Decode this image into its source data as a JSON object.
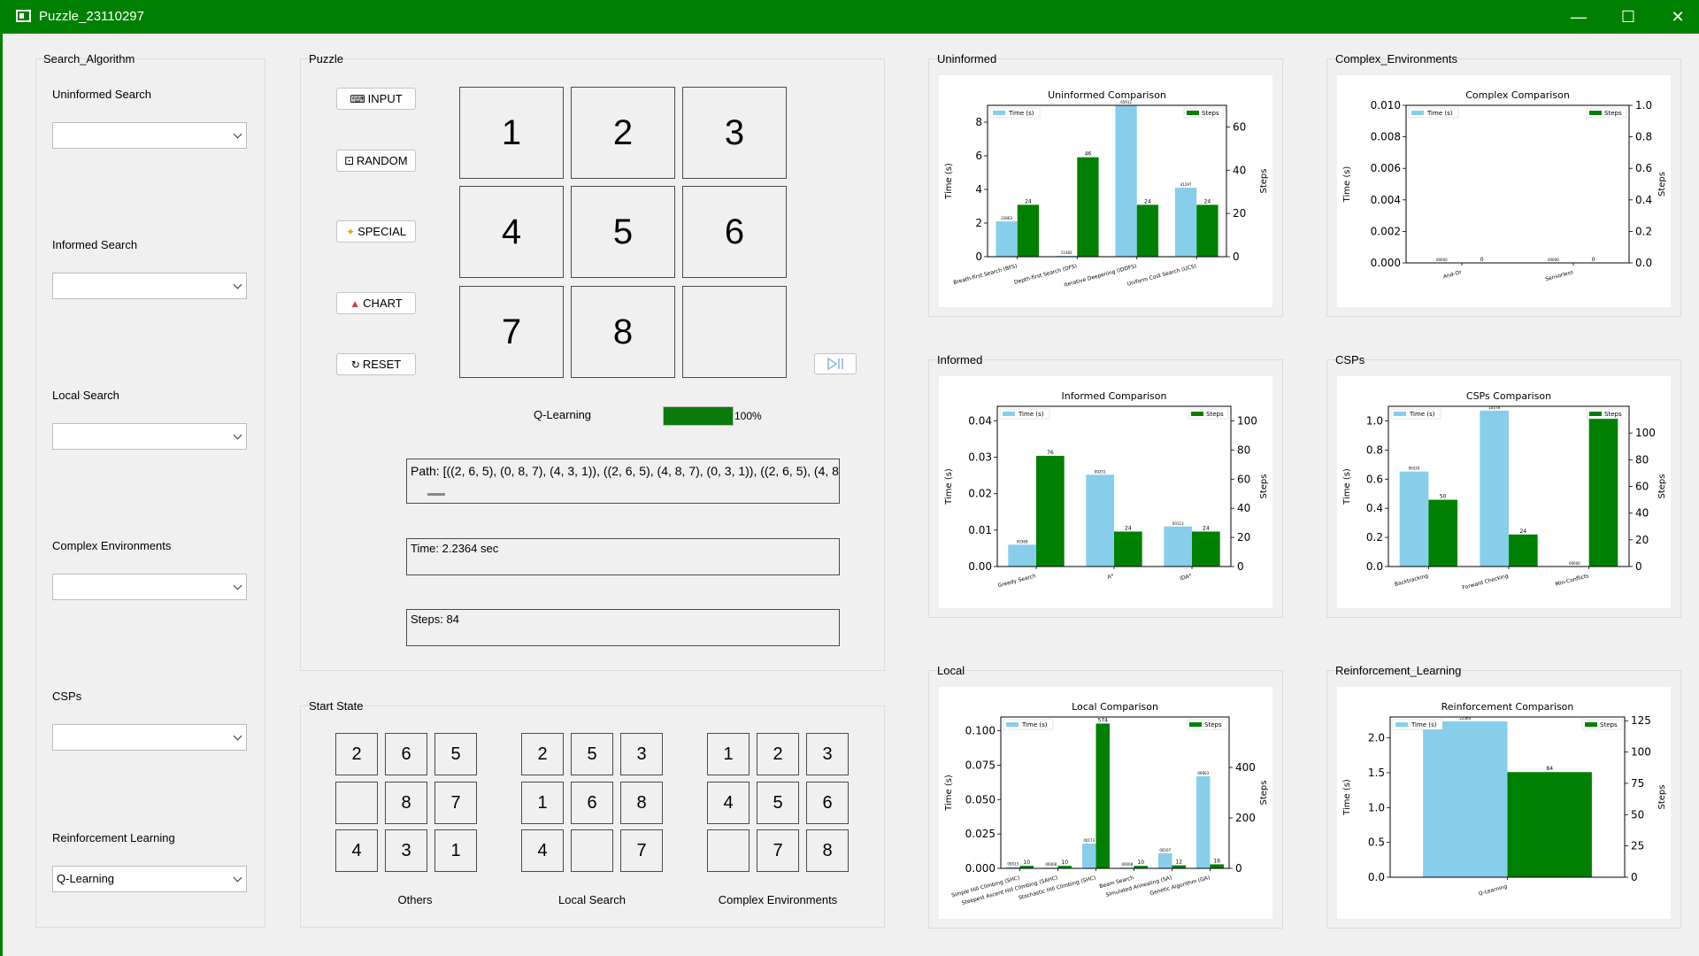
{
  "window": {
    "title": "Puzzle_23110297"
  },
  "sidebar": {
    "title": "Search_Algorithm",
    "groups": [
      {
        "label": "Uninformed Search",
        "value": ""
      },
      {
        "label": "Informed Search",
        "value": ""
      },
      {
        "label": "Local Search",
        "value": ""
      },
      {
        "label": "Complex Environments",
        "value": ""
      },
      {
        "label": "CSPs",
        "value": ""
      },
      {
        "label": "Reinforcement Learning",
        "value": "Q-Learning"
      }
    ]
  },
  "puzzle": {
    "title": "Puzzle",
    "buttons": [
      {
        "label": "INPUT",
        "icon": "keyboard-icon"
      },
      {
        "label": "RANDOM",
        "icon": "dice-icon"
      },
      {
        "label": "SPECIAL",
        "icon": "sparkle-icon"
      },
      {
        "label": "CHART",
        "icon": "chart-icon"
      },
      {
        "label": "RESET",
        "icon": "reset-icon"
      }
    ],
    "tiles": [
      "1",
      "2",
      "3",
      "4",
      "5",
      "6",
      "7",
      "8",
      ""
    ],
    "algorithm_label": "Q-Learning",
    "progress": {
      "value": 100,
      "text": "100%"
    },
    "path_text": "Path: [((2, 6, 5), (0, 8, 7), (4, 3, 1)), ((2, 6, 5), (4, 8, 7), (0, 3, 1)), ((2, 6, 5), (4, 8,",
    "time_text": "Time: 2.2364 sec",
    "steps_text": "Steps: 84"
  },
  "start_state": {
    "title": "Start State",
    "grids": [
      {
        "label": "Others",
        "tiles": [
          "2",
          "6",
          "5",
          "",
          "8",
          "7",
          "4",
          "3",
          "1"
        ]
      },
      {
        "label": "Local Search",
        "tiles": [
          "2",
          "5",
          "3",
          "1",
          "6",
          "8",
          "4",
          "",
          "7"
        ]
      },
      {
        "label": "Complex Environments",
        "tiles": [
          "1",
          "2",
          "3",
          "4",
          "5",
          "6",
          "",
          "7",
          "8"
        ]
      }
    ]
  },
  "panels": {
    "uninformed": "Uninformed",
    "complex": "Complex_Environments",
    "informed": "Informed",
    "csps": "CSPs",
    "local": "Local",
    "rl": "Reinforcement_Learning"
  },
  "colors": {
    "time": "#87ceeb",
    "steps": "#008000",
    "title_bar": "#008000"
  },
  "chart_data": [
    {
      "id": "uninformed",
      "type": "bar",
      "title": "Uninformed Comparison",
      "categories": [
        "Breath-first Search (BFS)",
        "Depth-first Search (DFS)",
        "Iterative Deepening (IDDFS)",
        "Uniform Cost Search (UCS)"
      ],
      "series": [
        {
          "name": "Time (s)",
          "values": [
            2.1,
            0.05,
            9.0,
            4.1
          ]
        },
        {
          "name": "Steps",
          "values": [
            24,
            46,
            24,
            24
          ]
        }
      ],
      "time_labels": [
        "22863",
        "11482",
        "65912",
        "41297"
      ],
      "steps_labels": [
        "24",
        "46",
        "24",
        "24"
      ],
      "ylabel_left": "Time (s)",
      "ylabel_right": "Steps",
      "ylim_left": [
        0,
        9
      ],
      "ylim_right": [
        0,
        70
      ],
      "left_ticks": [
        "0",
        "2",
        "4",
        "6",
        "8"
      ],
      "right_ticks": [
        "0",
        "20",
        "40",
        "60"
      ]
    },
    {
      "id": "complex",
      "type": "bar",
      "title": "Complex Comparison",
      "categories": [
        "And-Or",
        "Sensorless"
      ],
      "series": [
        {
          "name": "Time (s)",
          "values": [
            0,
            0
          ]
        },
        {
          "name": "Steps",
          "values": [
            0,
            0
          ]
        }
      ],
      "time_labels": [
        "00000",
        "00000"
      ],
      "steps_labels": [
        "0",
        "0"
      ],
      "ylabel_left": "Time (s)",
      "ylabel_right": "Steps",
      "ylim_left": [
        0,
        0.01
      ],
      "ylim_right": [
        0,
        1.0
      ],
      "left_ticks": [
        "0.000",
        "0.002",
        "0.004",
        "0.006",
        "0.008",
        "0.010"
      ],
      "right_ticks": [
        "0.0",
        "0.2",
        "0.4",
        "0.6",
        "0.8",
        "1.0"
      ]
    },
    {
      "id": "informed",
      "type": "bar",
      "title": "Informed Comparison",
      "categories": [
        "Greedy Search",
        "A*",
        "IDA*"
      ],
      "series": [
        {
          "name": "Time (s)",
          "values": [
            0.006,
            0.0252,
            0.011
          ]
        },
        {
          "name": "Steps",
          "values": [
            76,
            24,
            24
          ]
        }
      ],
      "time_labels": [
        "00368",
        "00251",
        "00113"
      ],
      "steps_labels": [
        "76",
        "24",
        "24"
      ],
      "ylabel_left": "Time (s)",
      "ylabel_right": "Steps",
      "ylim_left": [
        0,
        0.044
      ],
      "ylim_right": [
        0,
        110
      ],
      "left_ticks": [
        "0.00",
        "0.01",
        "0.02",
        "0.03",
        "0.04"
      ],
      "right_ticks": [
        "0",
        "20",
        "40",
        "60",
        "80",
        "100"
      ]
    },
    {
      "id": "csps",
      "type": "bar",
      "title": "CSPs Comparison",
      "categories": [
        "Backtracking",
        "Forward Checking",
        "Min-Conflicts"
      ],
      "series": [
        {
          "name": "Time (s)",
          "values": [
            0.652,
            1.07,
            0.0
          ]
        },
        {
          "name": "Steps",
          "values": [
            50,
            24,
            116
          ]
        }
      ],
      "time_labels": [
        "06520",
        "10578",
        "00000"
      ],
      "steps_labels": [
        "50",
        "24",
        ""
      ],
      "ylabel_left": "Time (s)",
      "ylabel_right": "Steps",
      "ylim_left": [
        0,
        1.1
      ],
      "ylim_right": [
        0,
        120
      ],
      "left_ticks": [
        "0.0",
        "0.2",
        "0.4",
        "0.6",
        "0.8",
        "1.0"
      ],
      "right_ticks": [
        "0",
        "20",
        "40",
        "60",
        "80",
        "100"
      ]
    },
    {
      "id": "local",
      "type": "bar",
      "title": "Local Comparison",
      "categories": [
        "Simple Hill Climbing (SHC)",
        "Steepest Ascent Hill Climbing (SAHC)",
        "Stochastic Hill Climbing (SHC)",
        "Beam Search",
        "Simulated Annealing (SA)",
        "Genetic Algorithm (GA)"
      ],
      "series": [
        {
          "name": "Time (s)",
          "values": [
            0.001,
            0.0005,
            0.018,
            0.0006,
            0.011,
            0.067
          ]
        },
        {
          "name": "Steps",
          "values": [
            10,
            10,
            574,
            10,
            12,
            16
          ]
        }
      ],
      "time_labels": [
        "00015",
        "00008",
        "00173",
        "00008",
        "00107",
        "00663"
      ],
      "steps_labels": [
        "10",
        "10",
        "574",
        "10",
        "12",
        "16"
      ],
      "ylabel_left": "Time (s)",
      "ylabel_right": "Steps",
      "ylim_left": [
        0,
        0.11
      ],
      "ylim_right": [
        0,
        600
      ],
      "left_ticks": [
        "0.000",
        "0.025",
        "0.050",
        "0.075",
        "0.100"
      ],
      "right_ticks": [
        "0",
        "200",
        "400"
      ]
    },
    {
      "id": "rl",
      "type": "bar",
      "title": "Reinforcement Comparison",
      "categories": [
        "Q-Learning"
      ],
      "series": [
        {
          "name": "Time (s)",
          "values": [
            2.2364
          ]
        },
        {
          "name": "Steps",
          "values": [
            84
          ]
        }
      ],
      "time_labels": [
        "22364"
      ],
      "steps_labels": [
        "84"
      ],
      "ylabel_left": "Time (s)",
      "ylabel_right": "Steps",
      "ylim_left": [
        0,
        2.3
      ],
      "ylim_right": [
        0,
        128
      ],
      "left_ticks": [
        "0.0",
        "0.5",
        "1.0",
        "1.5",
        "2.0"
      ],
      "right_ticks": [
        "0",
        "25",
        "50",
        "75",
        "100",
        "125"
      ]
    }
  ]
}
